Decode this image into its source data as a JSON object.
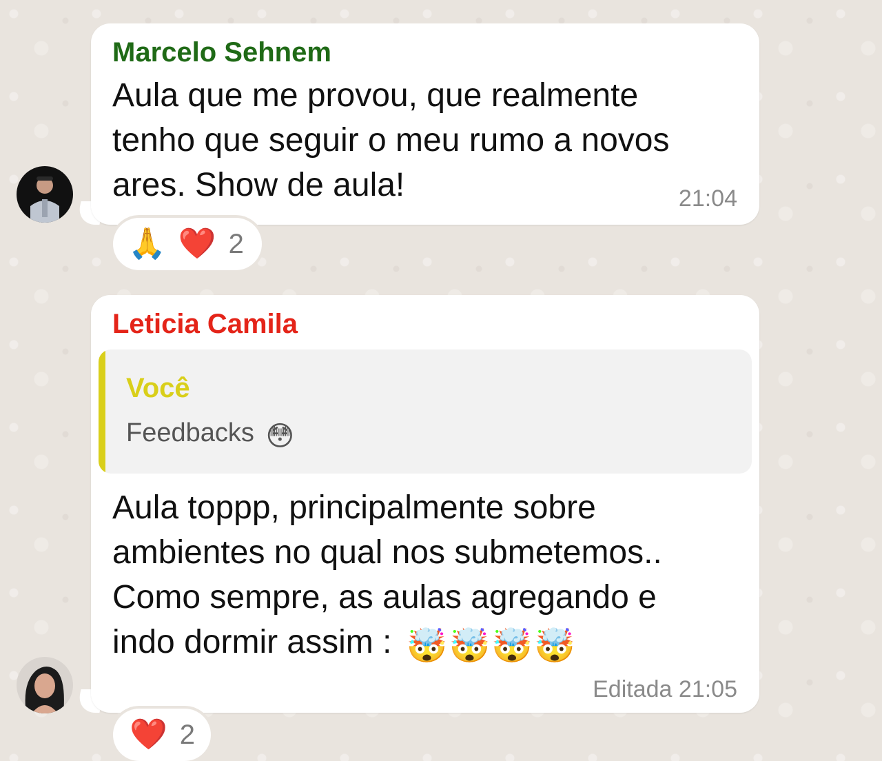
{
  "messages": [
    {
      "sender": "Marcelo Sehnem",
      "sender_color": "#1f6a16",
      "lines": [
        "Aula que me provou, que realmente",
        "tenho que seguir o meu rumo a novos",
        "ares. Show de aula!"
      ],
      "time": "21:04",
      "reactions": {
        "emoji_1": "🙏",
        "emoji_2": "❤️",
        "count": "2"
      }
    },
    {
      "sender": "Leticia Camila",
      "sender_color": "#e42419",
      "quote": {
        "author": "Você",
        "author_color": "#d9cf1a",
        "text": "Feedbacks",
        "emoji": "😳"
      },
      "lines": [
        "Aula toppp, principalmente sobre",
        "ambientes no qual nos submetemos..",
        "Como sempre, as aulas agregando e",
        "indo dormir assim :"
      ],
      "line_emojis": "🤯🤯🤯🤯",
      "edited_label": "Editada",
      "time": "21:05",
      "reactions": {
        "emoji_1": "❤️",
        "count": "2"
      }
    }
  ]
}
